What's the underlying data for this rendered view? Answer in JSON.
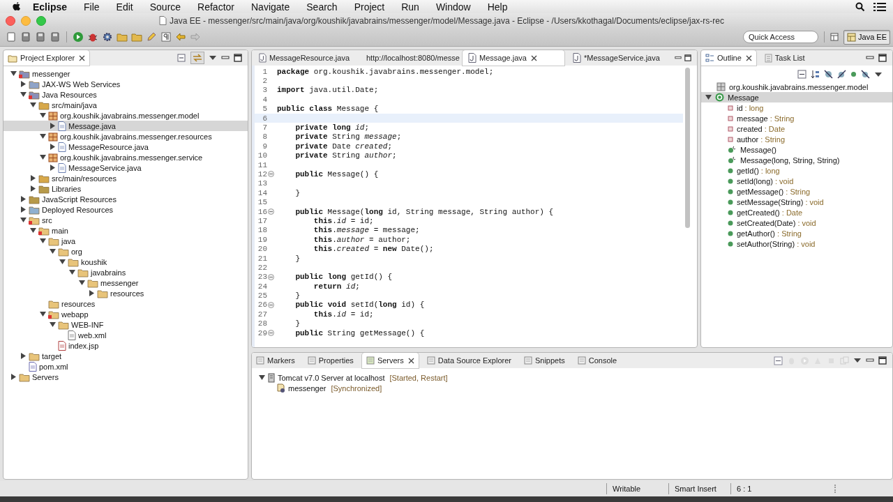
{
  "menubar": {
    "app": "Eclipse",
    "items": [
      "File",
      "Edit",
      "Source",
      "Refactor",
      "Navigate",
      "Search",
      "Project",
      "Run",
      "Window",
      "Help"
    ]
  },
  "window": {
    "title": "Java EE - messenger/src/main/java/org/koushik/javabrains/messenger/model/Message.java - Eclipse - /Users/kkothagal/Documents/eclipse/jax-rs-rec"
  },
  "toolbar": {
    "quick_access": {
      "placeholder": "Quick Access"
    },
    "perspective": {
      "label": "Java EE",
      "selected": true
    }
  },
  "explorer": {
    "tab": {
      "label": "Project Explorer",
      "selected": true
    },
    "tree": [
      {
        "label": "messenger",
        "kind": "project",
        "expanded": true,
        "selected": false,
        "children": [
          {
            "label": "JAX-WS Web Services",
            "kind": "webservice",
            "expanded": false,
            "selected": false
          },
          {
            "label": "Java Resources",
            "kind": "project",
            "expanded": true,
            "selected": false,
            "children": [
              {
                "label": "src/main/java",
                "kind": "source",
                "expanded": true,
                "selected": false,
                "children": [
                  {
                    "label": "org.koushik.javabrains.messenger.model",
                    "kind": "package",
                    "expanded": true,
                    "selected": false,
                    "children": [
                      {
                        "label": "Message.java",
                        "kind": "java",
                        "expanded": false,
                        "selected": true
                      }
                    ]
                  },
                  {
                    "label": "org.koushik.javabrains.messenger.resources",
                    "kind": "package",
                    "expanded": true,
                    "selected": false,
                    "children": [
                      {
                        "label": "MessageResource.java",
                        "kind": "java",
                        "expanded": false,
                        "selected": false
                      }
                    ]
                  },
                  {
                    "label": "org.koushik.javabrains.messenger.service",
                    "kind": "package",
                    "expanded": true,
                    "selected": false,
                    "children": [
                      {
                        "label": "MessageService.java",
                        "kind": "java",
                        "expanded": false,
                        "selected": false
                      }
                    ]
                  }
                ]
              },
              {
                "label": "src/main/resources",
                "kind": "source",
                "expanded": false,
                "selected": false
              },
              {
                "label": "Libraries",
                "kind": "library",
                "expanded": false,
                "selected": false
              }
            ]
          },
          {
            "label": "JavaScript Resources",
            "kind": "library",
            "expanded": false,
            "selected": false
          },
          {
            "label": "Deployed Resources",
            "kind": "deployed",
            "expanded": false,
            "selected": false
          },
          {
            "label": "src",
            "kind": "errfolder",
            "expanded": true,
            "selected": false,
            "children": [
              {
                "label": "main",
                "kind": "errfolder",
                "expanded": true,
                "selected": false,
                "children": [
                  {
                    "label": "java",
                    "kind": "folder",
                    "expanded": true,
                    "selected": false,
                    "children": [
                      {
                        "label": "org",
                        "kind": "folder",
                        "expanded": true,
                        "selected": false,
                        "children": [
                          {
                            "label": "koushik",
                            "kind": "folder",
                            "expanded": true,
                            "selected": false,
                            "children": [
                              {
                                "label": "javabrains",
                                "kind": "folder",
                                "expanded": true,
                                "selected": false,
                                "children": [
                                  {
                                    "label": "messenger",
                                    "kind": "folder",
                                    "expanded": true,
                                    "selected": false,
                                    "children": [
                                      {
                                        "label": "resources",
                                        "kind": "folder",
                                        "expanded": false,
                                        "selected": false
                                      }
                                    ]
                                  }
                                ]
                              }
                            ]
                          }
                        ]
                      }
                    ]
                  },
                  {
                    "label": "resources",
                    "kind": "folder",
                    "selected": false
                  },
                  {
                    "label": "webapp",
                    "kind": "errfolder",
                    "expanded": true,
                    "selected": false,
                    "children": [
                      {
                        "label": "WEB-INF",
                        "kind": "folder",
                        "expanded": true,
                        "selected": false,
                        "children": [
                          {
                            "label": "web.xml",
                            "kind": "xml",
                            "selected": false
                          }
                        ]
                      },
                      {
                        "label": "index.jsp",
                        "kind": "jsp",
                        "selected": false
                      }
                    ]
                  }
                ]
              }
            ]
          },
          {
            "label": "target",
            "kind": "folder",
            "expanded": false,
            "selected": false
          },
          {
            "label": "pom.xml",
            "kind": "pom",
            "selected": false
          }
        ]
      },
      {
        "label": "Servers",
        "kind": "folder",
        "expanded": false,
        "selected": false
      }
    ]
  },
  "editor": {
    "tabs": [
      {
        "label": "MessageResource.java",
        "kind": "java",
        "selected": false
      },
      {
        "label": "http://localhost:8080/messe",
        "kind": "web",
        "selected": false
      },
      {
        "label": "Message.java",
        "kind": "java",
        "selected": true
      },
      {
        "label": "*MessageService.java",
        "kind": "java",
        "selected": false
      }
    ],
    "lines": [
      {
        "n": "1",
        "code": "**package** org.koushik.javabrains.messenger.model;",
        "current": false,
        "foldable": false
      },
      {
        "n": "2",
        "current": false,
        "foldable": false
      },
      {
        "n": "3",
        "code": "**import** java.util.Date;",
        "current": false,
        "foldable": false
      },
      {
        "n": "4",
        "current": false,
        "foldable": false
      },
      {
        "n": "5",
        "code": "**public** **class** Message {",
        "current": false,
        "foldable": false
      },
      {
        "n": "6",
        "current": true,
        "foldable": false
      },
      {
        "n": "7",
        "code": "    **private** **long** *id*;",
        "current": false,
        "foldable": false
      },
      {
        "n": "8",
        "code": "    **private** String *message*;",
        "current": false,
        "foldable": false
      },
      {
        "n": "9",
        "code": "    **private** Date *created*;",
        "current": false,
        "foldable": false
      },
      {
        "n": "10",
        "code": "    **private** String *author*;",
        "current": false,
        "foldable": false
      },
      {
        "n": "11",
        "current": false,
        "foldable": false
      },
      {
        "n": "12",
        "code": "    **public** Message() {",
        "current": false,
        "foldable": true
      },
      {
        "n": "13",
        "current": false,
        "foldable": false
      },
      {
        "n": "14",
        "code": "    }",
        "current": false,
        "foldable": false
      },
      {
        "n": "15",
        "current": false,
        "foldable": false
      },
      {
        "n": "16",
        "code": "    **public** Message(**long** id, String message, String author) {",
        "current": false,
        "foldable": true
      },
      {
        "n": "17",
        "code": "        **this**.*id* = id;",
        "current": false,
        "foldable": false
      },
      {
        "n": "18",
        "code": "        **this**.*message* = message;",
        "current": false,
        "foldable": false
      },
      {
        "n": "19",
        "code": "        **this**.*author* = author;",
        "current": false,
        "foldable": false
      },
      {
        "n": "20",
        "code": "        **this**.*created* = **new** Date();",
        "current": false,
        "foldable": false
      },
      {
        "n": "21",
        "code": "    }",
        "current": false,
        "foldable": false
      },
      {
        "n": "22",
        "current": false,
        "foldable": false
      },
      {
        "n": "23",
        "code": "    **public** **long** getId() {",
        "current": false,
        "foldable": true
      },
      {
        "n": "24",
        "code": "        **return** *id*;",
        "current": false,
        "foldable": false
      },
      {
        "n": "25",
        "code": "    }",
        "current": false,
        "foldable": false
      },
      {
        "n": "26",
        "code": "    **public** **void** setId(**long** id) {",
        "current": false,
        "foldable": true
      },
      {
        "n": "27",
        "code": "        **this**.*id* = id;",
        "current": false,
        "foldable": false
      },
      {
        "n": "28",
        "code": "    }",
        "current": false,
        "foldable": false
      },
      {
        "n": "29",
        "code": "    **public** String getMessage() {",
        "current": false,
        "foldable": true
      }
    ]
  },
  "outline": {
    "tabs": [
      {
        "label": "Outline",
        "selected": true
      },
      {
        "label": "Task List",
        "selected": false
      }
    ],
    "package": "org.koushik.javabrains.messenger.model",
    "class": {
      "name": "Message",
      "expanded": true,
      "selected": true
    },
    "members": [
      {
        "name": "id",
        "type": ": long",
        "kind": "field"
      },
      {
        "name": "message",
        "type": ": String",
        "kind": "field"
      },
      {
        "name": "created",
        "type": ": Date",
        "kind": "field"
      },
      {
        "name": "author",
        "type": ": String",
        "kind": "field"
      },
      {
        "name": "Message()",
        "kind": "constructor"
      },
      {
        "name": "Message(long, String, String)",
        "kind": "constructor"
      },
      {
        "name": "getId()",
        "type": ": long",
        "kind": "method"
      },
      {
        "name": "setId(long)",
        "type": ": void",
        "kind": "method"
      },
      {
        "name": "getMessage()",
        "type": ": String",
        "kind": "method"
      },
      {
        "name": "setMessage(String)",
        "type": ": void",
        "kind": "method"
      },
      {
        "name": "getCreated()",
        "type": ": Date",
        "kind": "method"
      },
      {
        "name": "setCreated(Date)",
        "type": ": void",
        "kind": "method"
      },
      {
        "name": "getAuthor()",
        "type": ": String",
        "kind": "method"
      },
      {
        "name": "setAuthor(String)",
        "type": ": void",
        "kind": "method"
      }
    ]
  },
  "bottom": {
    "tabs": [
      {
        "label": "Markers",
        "selected": false
      },
      {
        "label": "Properties",
        "selected": false
      },
      {
        "label": "Servers",
        "selected": true
      },
      {
        "label": "Data Source Explorer",
        "selected": false
      },
      {
        "label": "Snippets",
        "selected": false
      },
      {
        "label": "Console",
        "selected": false
      }
    ],
    "servers": [
      {
        "name": "Tomcat v7.0 Server at localhost",
        "status": "[Started, Restart]",
        "expanded": true,
        "children": [
          {
            "name": "messenger",
            "status": "[Synchronized]"
          }
        ]
      }
    ]
  },
  "status_bar": [
    "Writable",
    "Smart Insert",
    "6 : 1"
  ]
}
